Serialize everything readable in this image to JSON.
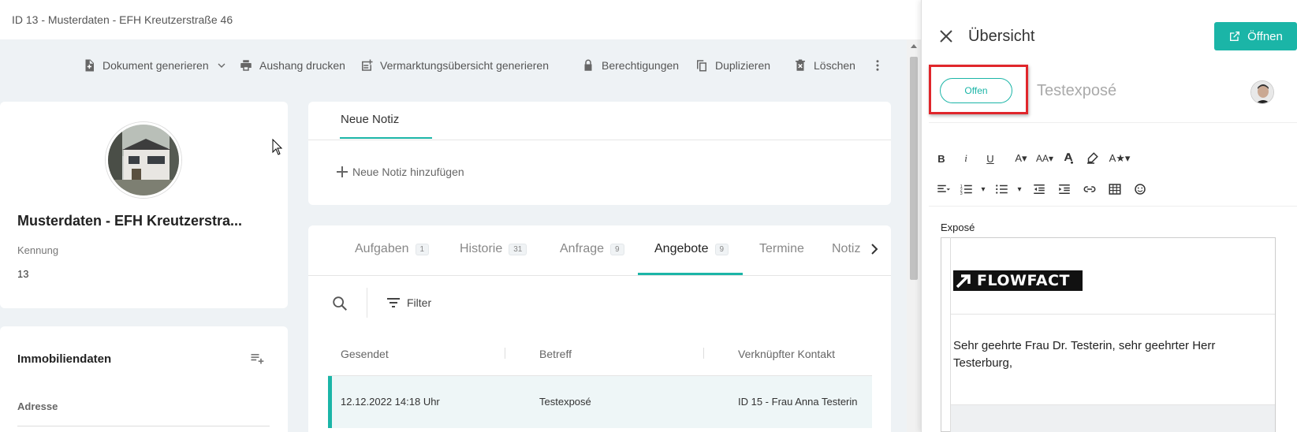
{
  "breadcrumb": "ID 13 - Musterdaten - EFH Kreutzerstraße 46",
  "toolbar": {
    "doc_generate": "Dokument generieren",
    "print_notice": "Aushang drucken",
    "marketing_overview": "Vermarktungsübersicht generieren",
    "permissions": "Berechtigungen",
    "duplicate": "Duplizieren",
    "delete": "Löschen"
  },
  "property": {
    "title": "Musterdaten - EFH Kreutzerstra...",
    "id_label": "Kennung",
    "id_value": "13"
  },
  "immo": {
    "title": "Immobiliendaten",
    "address_label": "Adresse"
  },
  "notes": {
    "tab_label": "Neue Notiz",
    "add_label": "Neue Notiz hinzufügen"
  },
  "tabs": [
    {
      "label": "Aufgaben",
      "count": "1"
    },
    {
      "label": "Historie",
      "count": "31"
    },
    {
      "label": "Anfrage",
      "count": "9"
    },
    {
      "label": "Angebote",
      "count": "9"
    },
    {
      "label": "Termine",
      "count": ""
    },
    {
      "label": "Notiz",
      "count": ""
    }
  ],
  "filter_label": "Filter",
  "table": {
    "headers": [
      "Gesendet",
      "Betreff",
      "Verknüpfter Kontakt"
    ],
    "rows": [
      [
        "12.12.2022 14:18 Uhr",
        "Testexposé",
        "ID 15 - Frau Anna Testerin"
      ]
    ]
  },
  "panel": {
    "title": "Übersicht",
    "open_button": "Öffnen",
    "status": "Offen",
    "subject": "Testexposé",
    "editor_label": "Exposé",
    "logo_text": "FLOWFACT",
    "letter_text": "Sehr geehrte Frau Dr. Testerin, sehr geehrter Herr Testerburg,"
  },
  "colors": {
    "accent": "#1bb5a7",
    "highlight": "#e0262b"
  }
}
